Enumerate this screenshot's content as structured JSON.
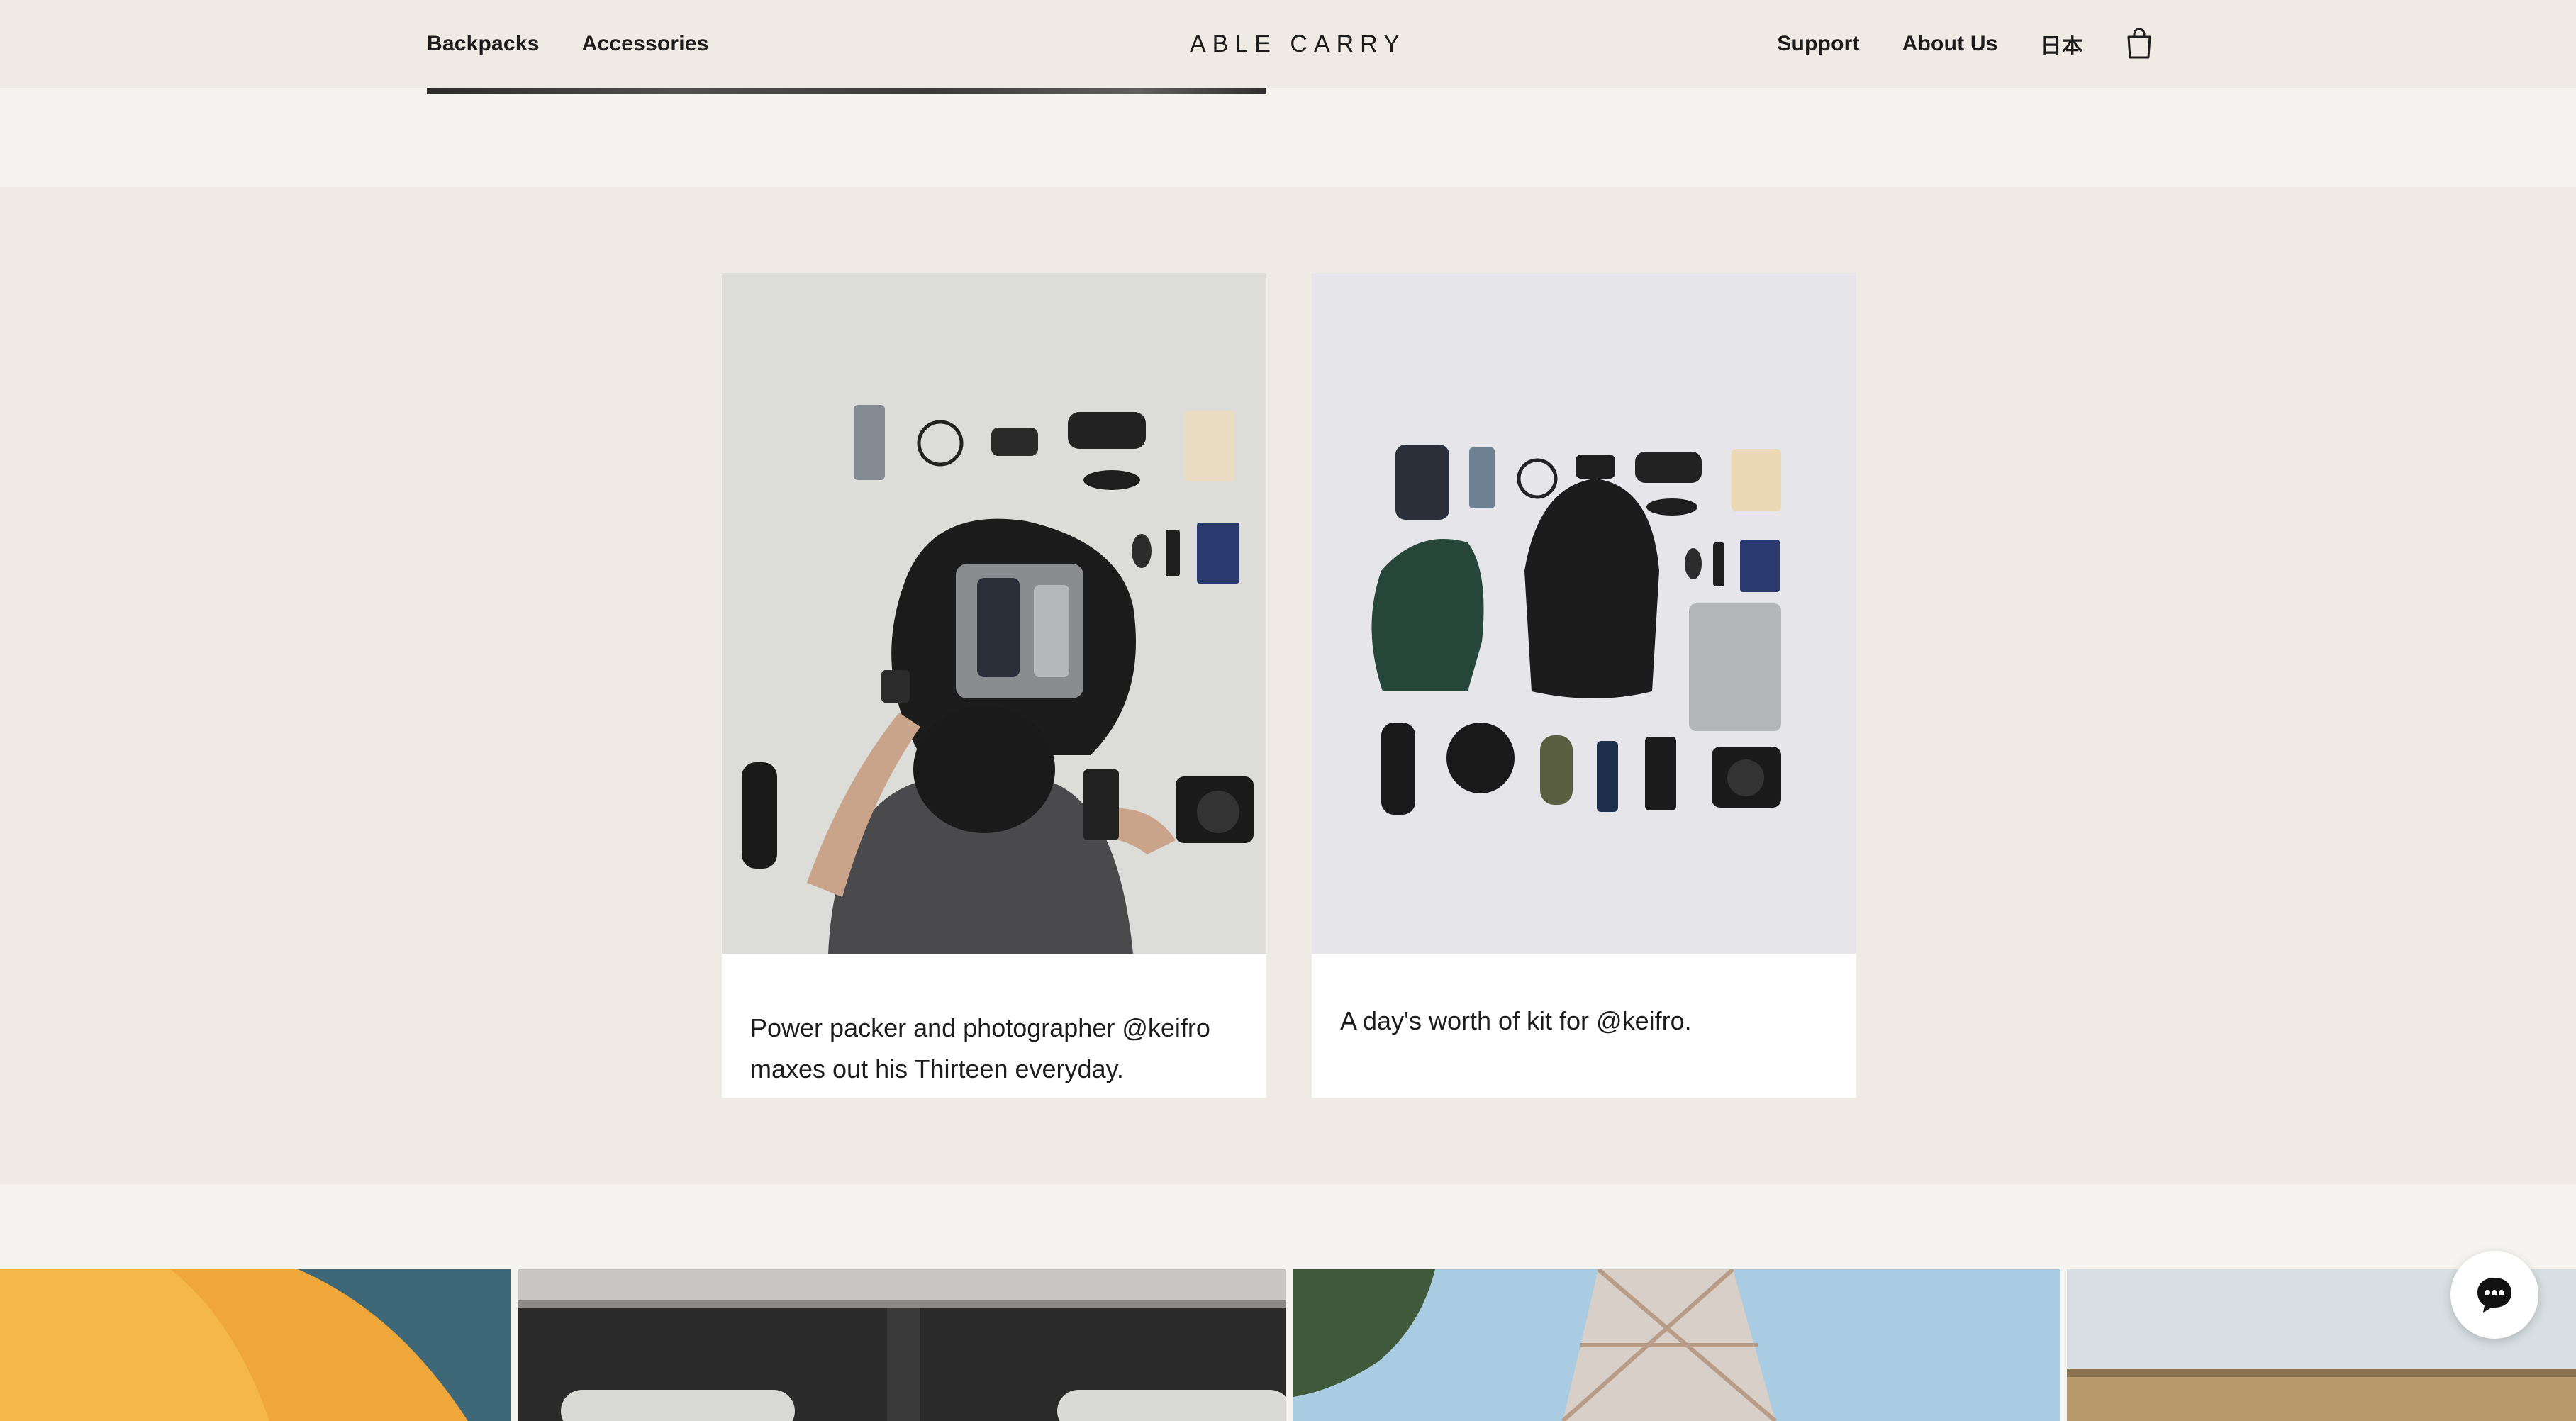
{
  "header": {
    "nav_left": [
      {
        "label": "Backpacks"
      },
      {
        "label": "Accessories"
      }
    ],
    "brand": "ABLE CARRY",
    "nav_right": [
      {
        "label": "Support"
      },
      {
        "label": "About Us"
      },
      {
        "label": "日本"
      }
    ],
    "cart_icon": "shopping-bag-icon"
  },
  "feature": {
    "cards": [
      {
        "image": "photographer-packing-backpack-flatlay",
        "caption": "Power packer and photographer @keifro maxes out his Thirteen everyday."
      },
      {
        "image": "everyday-carry-kit-flatlay",
        "caption": "A day's worth of kit for @keifro."
      }
    ]
  },
  "gallery": {
    "tiles": [
      {
        "image": "orange-kayak-on-water"
      },
      {
        "image": "train-interior-windows"
      },
      {
        "image": "tokyo-tower-blue-sky"
      },
      {
        "image": "building-facade"
      }
    ]
  },
  "chat": {
    "icon": "chat-bubble-icon"
  },
  "colors": {
    "header_bg": "#f0eae4",
    "page_bg": "#f6f4f0",
    "section_bg": "#f0eae4",
    "text": "#1c1c1c"
  }
}
